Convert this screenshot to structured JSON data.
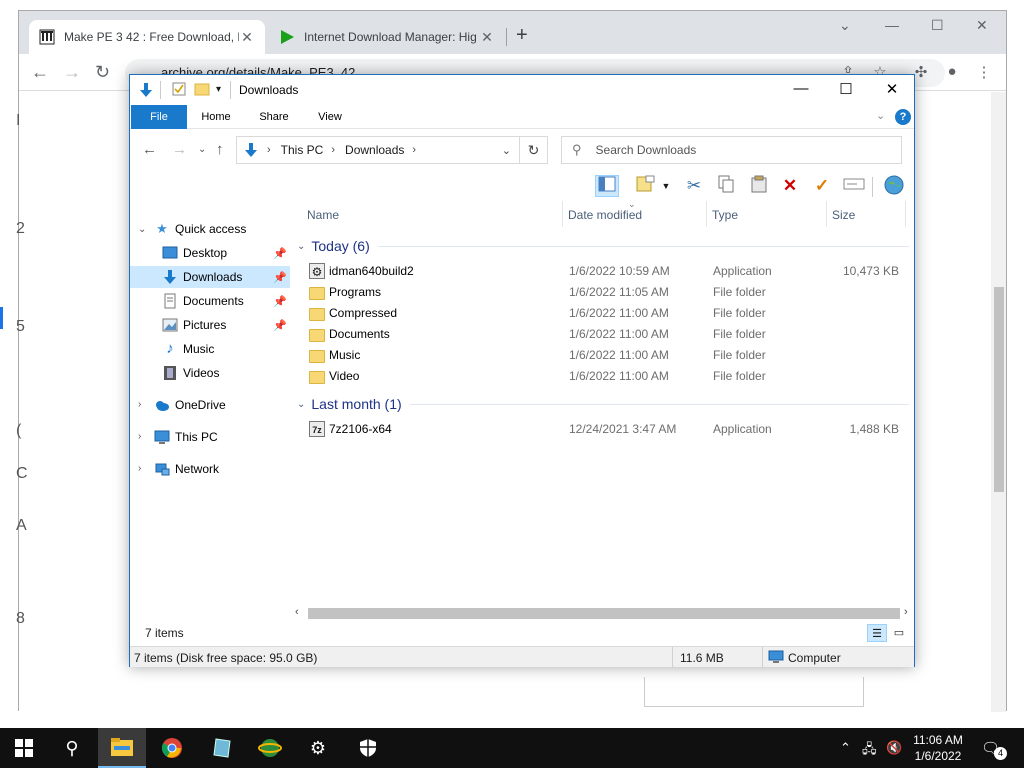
{
  "browser": {
    "tabs": [
      {
        "title": "Make PE 3 42 : Free Download, B",
        "close": "✕"
      },
      {
        "title": "Internet Download Manager: Hig",
        "close": "✕"
      }
    ],
    "new_tab": "+",
    "url": "archive.org/details/Make_PE3_42",
    "window_controls": [
      "⌄",
      "—",
      "☐",
      "✕"
    ],
    "page_left_chars": [
      "I",
      "2",
      "5",
      "(",
      "C",
      "A",
      "8"
    ]
  },
  "explorer": {
    "title": "Downloads",
    "window_controls": {
      "minimize": "—",
      "maximize": "☐",
      "close": "✕"
    },
    "ribbon_tabs": [
      "File",
      "Home",
      "Share",
      "View"
    ],
    "help": "?",
    "address": {
      "crumbs": [
        "This PC",
        "Downloads"
      ],
      "sep": "›"
    },
    "search_placeholder": "Search Downloads",
    "nav": {
      "quick_access": "Quick access",
      "desktop": "Desktop",
      "downloads": "Downloads",
      "documents": "Documents",
      "pictures": "Pictures",
      "music": "Music",
      "videos": "Videos",
      "onedrive": "OneDrive",
      "this_pc": "This PC",
      "network": "Network"
    },
    "columns": {
      "name": "Name",
      "date": "Date modified",
      "type": "Type",
      "size": "Size"
    },
    "groups": [
      {
        "label": "Today (6)"
      },
      {
        "label": "Last month (1)"
      }
    ],
    "files": [
      {
        "name": "idman640build2",
        "date": "1/6/2022 10:59 AM",
        "type": "Application",
        "size": "10,473 KB"
      },
      {
        "name": "Programs",
        "date": "1/6/2022 11:05 AM",
        "type": "File folder",
        "size": ""
      },
      {
        "name": "Compressed",
        "date": "1/6/2022 11:00 AM",
        "type": "File folder",
        "size": ""
      },
      {
        "name": "Documents",
        "date": "1/6/2022 11:00 AM",
        "type": "File folder",
        "size": ""
      },
      {
        "name": "Music",
        "date": "1/6/2022 11:00 AM",
        "type": "File folder",
        "size": ""
      },
      {
        "name": "Video",
        "date": "1/6/2022 11:00 AM",
        "type": "File folder",
        "size": ""
      },
      {
        "name": "7z2106-x64",
        "date": "12/24/2021 3:47 AM",
        "type": "Application",
        "size": "1,488 KB"
      }
    ],
    "item_count": "7 items",
    "status": {
      "left": "7 items (Disk free space: 95.0 GB)",
      "size": "11.6 MB",
      "location": "Computer"
    }
  },
  "taskbar": {
    "clock_time": "11:06 AM",
    "clock_date": "1/6/2022",
    "notification_count": "4"
  },
  "colors": {
    "accent": "#1979ca",
    "selection": "#cce8ff",
    "folder": "#f8d775",
    "group_text": "#1e3287"
  }
}
